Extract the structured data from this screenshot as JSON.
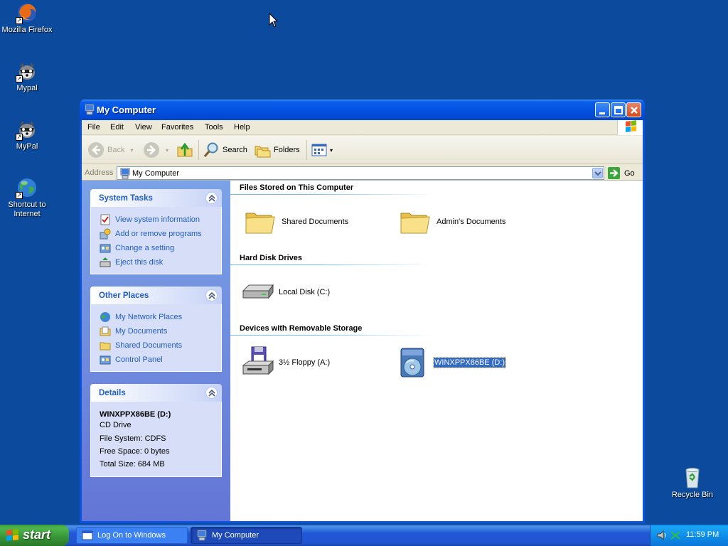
{
  "desktop": {
    "icons": [
      {
        "label": "Mozilla Firefox"
      },
      {
        "label": "Mypal"
      },
      {
        "label": "MyPal"
      },
      {
        "label": "Shortcut to Internet"
      },
      {
        "label": "Recycle Bin"
      }
    ]
  },
  "window": {
    "title": "My Computer",
    "menu": [
      "File",
      "Edit",
      "View",
      "Favorites",
      "Tools",
      "Help"
    ],
    "toolbar": {
      "back": "Back",
      "search": "Search",
      "folders": "Folders"
    },
    "address": {
      "label": "Address",
      "value": "My Computer",
      "go": "Go"
    }
  },
  "tasks": {
    "system": {
      "title": "System Tasks",
      "links": [
        "View system information",
        "Add or remove programs",
        "Change a setting",
        "Eject this disk"
      ]
    },
    "places": {
      "title": "Other Places",
      "links": [
        "My Network Places",
        "My Documents",
        "Shared Documents",
        "Control Panel"
      ]
    },
    "details": {
      "title": "Details",
      "name": "WINXPPX86BE (D:)",
      "type": "CD Drive",
      "fs": "File System: CDFS",
      "free": "Free Space: 0 bytes",
      "total": "Total Size: 684 MB"
    }
  },
  "content": {
    "groups": [
      {
        "title": "Files Stored on This Computer",
        "items": [
          "Shared Documents",
          "Admin's Documents"
        ]
      },
      {
        "title": "Hard Disk Drives",
        "items": [
          "Local Disk (C:)"
        ]
      },
      {
        "title": "Devices with Removable Storage",
        "items": [
          "3½ Floppy (A:)",
          "WINXPPX86BE (D:)"
        ]
      }
    ]
  },
  "taskbar": {
    "start": "start",
    "tasks": [
      "Log On to Windows",
      "My Computer"
    ],
    "clock": "11:59 PM"
  },
  "colors": {
    "desktop": "#0b4a9c",
    "link": "#215dc6",
    "selection": "#316ac5"
  }
}
